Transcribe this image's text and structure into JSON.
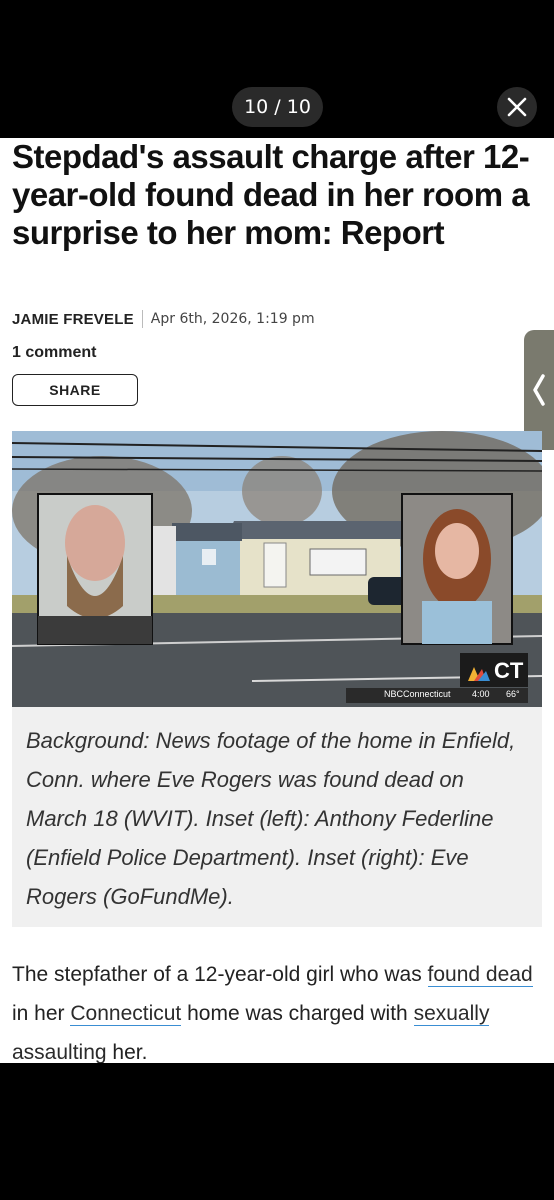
{
  "viewer": {
    "counter": "10 / 10"
  },
  "article": {
    "title": "Stepdad's assault charge after 12-year-old found dead in her room a surprise to her mom: Report",
    "author": "JAMIE FREVELE",
    "date": "Apr 6th, 2026, 1:19 pm",
    "comments": "1 comment",
    "share_label": "SHARE",
    "image": {
      "logo": "CT",
      "ticker_source": "NBCConnecticut",
      "ticker_time": "4:00",
      "ticker_temp": "66°"
    },
    "caption": "Background: News footage of the home in Enfield, Conn. where Eve Rogers was found dead on March 18 (WVIT). Inset (left): Anthony Federline (Enfield Police Department). Inset (right): Eve Rogers (GoFundMe).",
    "body": {
      "t1": "The stepfather of a 12-year-old girl who was ",
      "link1": "found dead",
      "t2": " in her ",
      "link2": "Connecticut",
      "t3": " home was charged with ",
      "link3": "sexually assaulting",
      "t4": " her."
    }
  },
  "icons": {
    "close": "close-icon",
    "side_tab": "chevron-left-icon",
    "logo": "nbc-peacock-icon"
  },
  "colors": {
    "link_underline": "#3a8ed3",
    "caption_bg": "#f0f0f0"
  }
}
